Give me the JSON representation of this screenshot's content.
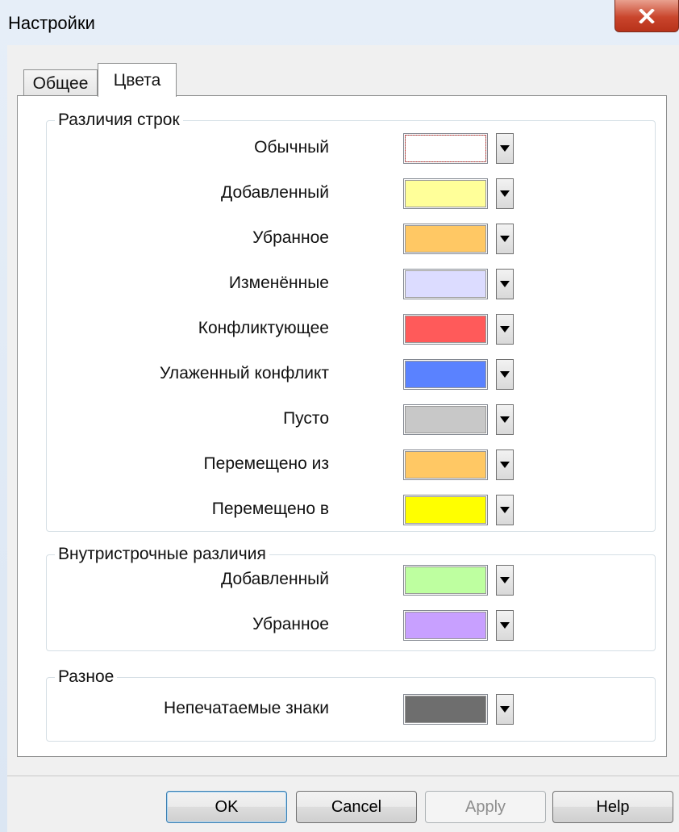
{
  "window": {
    "title": "Настройки"
  },
  "tabs": [
    {
      "label": "Общее",
      "active": false
    },
    {
      "label": "Цвета",
      "active": true
    }
  ],
  "groups": {
    "line_diffs": {
      "title": "Различия строк",
      "items": [
        {
          "label": "Обычный",
          "color": "#FFFFFF"
        },
        {
          "label": "Добавленный",
          "color": "#FFFF99"
        },
        {
          "label": "Убранное",
          "color": "#FFC864"
        },
        {
          "label": "Изменённые",
          "color": "#DCDCFF"
        },
        {
          "label": "Конфликтующее",
          "color": "#FF5A5A"
        },
        {
          "label": "Улаженный конфликт",
          "color": "#5A82FF"
        },
        {
          "label": "Пусто",
          "color": "#C8C8C8"
        },
        {
          "label": "Перемещено из",
          "color": "#FFC864"
        },
        {
          "label": "Перемещено в",
          "color": "#FFFF00"
        }
      ]
    },
    "inline_diffs": {
      "title": "Внутристрочные различия",
      "items": [
        {
          "label": "Добавленный",
          "color": "#BEFFA0"
        },
        {
          "label": "Убранное",
          "color": "#C8A0FF"
        }
      ]
    },
    "misc": {
      "title": "Разное",
      "items": [
        {
          "label": "Непечатаемые знаки",
          "color": "#6E6E6E"
        }
      ]
    }
  },
  "buttons": {
    "ok": "OK",
    "cancel": "Cancel",
    "apply": "Apply",
    "help": "Help"
  },
  "icons": {
    "close": "close-icon",
    "dropdown": "chevron-down-icon"
  }
}
